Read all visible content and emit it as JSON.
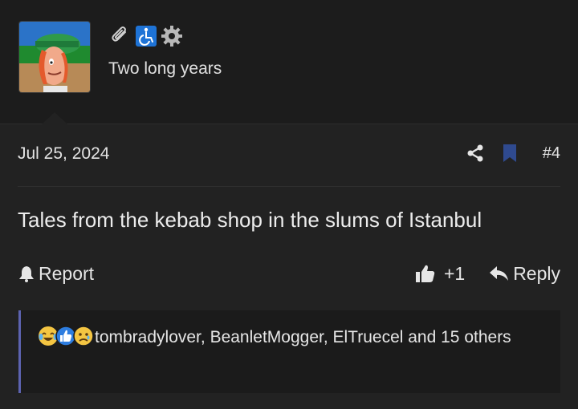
{
  "user": {
    "title": "Two long years",
    "badges": [
      "paperclip-icon",
      "wheelchair-icon",
      "gear-icon"
    ]
  },
  "post": {
    "date": "Jul 25, 2024",
    "number": "#4",
    "body": "Tales from the kebab shop in the slums of Istanbul"
  },
  "actions": {
    "report": "Report",
    "like_count": "+1",
    "reply": "Reply"
  },
  "reactions": {
    "icons": [
      "laugh-cry-icon",
      "thumbs-up-icon",
      "sad-icon"
    ],
    "text": "tombradylover, BeanletMogger, ElTruecel and 15 others"
  },
  "colors": {
    "background": "#222222",
    "header_background": "#1c1c1c",
    "accent": "#5c63b0",
    "bookmark": "#2f4a8f",
    "wheelchair_badge": "#1e73d6"
  }
}
